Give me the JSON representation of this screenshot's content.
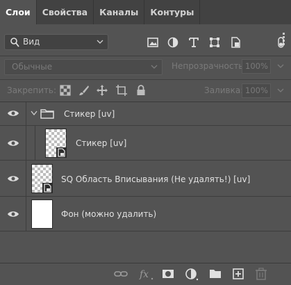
{
  "tabs": [
    {
      "label": "Слои",
      "active": true
    },
    {
      "label": "Свойства",
      "active": false
    },
    {
      "label": "Каналы",
      "active": false
    },
    {
      "label": "Контуры",
      "active": false
    }
  ],
  "filter": {
    "label": "Вид",
    "icons": [
      "image-filter-icon",
      "adjustment-filter-icon",
      "type-filter-icon",
      "shape-filter-icon",
      "smart-object-filter-icon",
      "filter-toggle-icon"
    ]
  },
  "blend": {
    "mode": "Обычные"
  },
  "opacity": {
    "label": "Непрозрачность:",
    "value": "100%"
  },
  "lock": {
    "label": "Закрепить:"
  },
  "fill": {
    "label": "Заливка:",
    "value": "100%"
  },
  "layers": [
    {
      "name": "Стикер [uv]",
      "type": "group",
      "visible": true
    },
    {
      "name": "Стикер [uv]",
      "type": "smart-object",
      "visible": true,
      "indent": 1
    },
    {
      "name": "SQ Область Вписывания (Не удалять!) [uv]",
      "type": "smart-object",
      "visible": true
    },
    {
      "name": "Фон (можно удалить)",
      "type": "pixel",
      "visible": true
    }
  ],
  "colors": {
    "panel": "#535353",
    "tabbar": "#424242",
    "text": "#e0e0e0",
    "disabled": "#7a7a7a"
  }
}
